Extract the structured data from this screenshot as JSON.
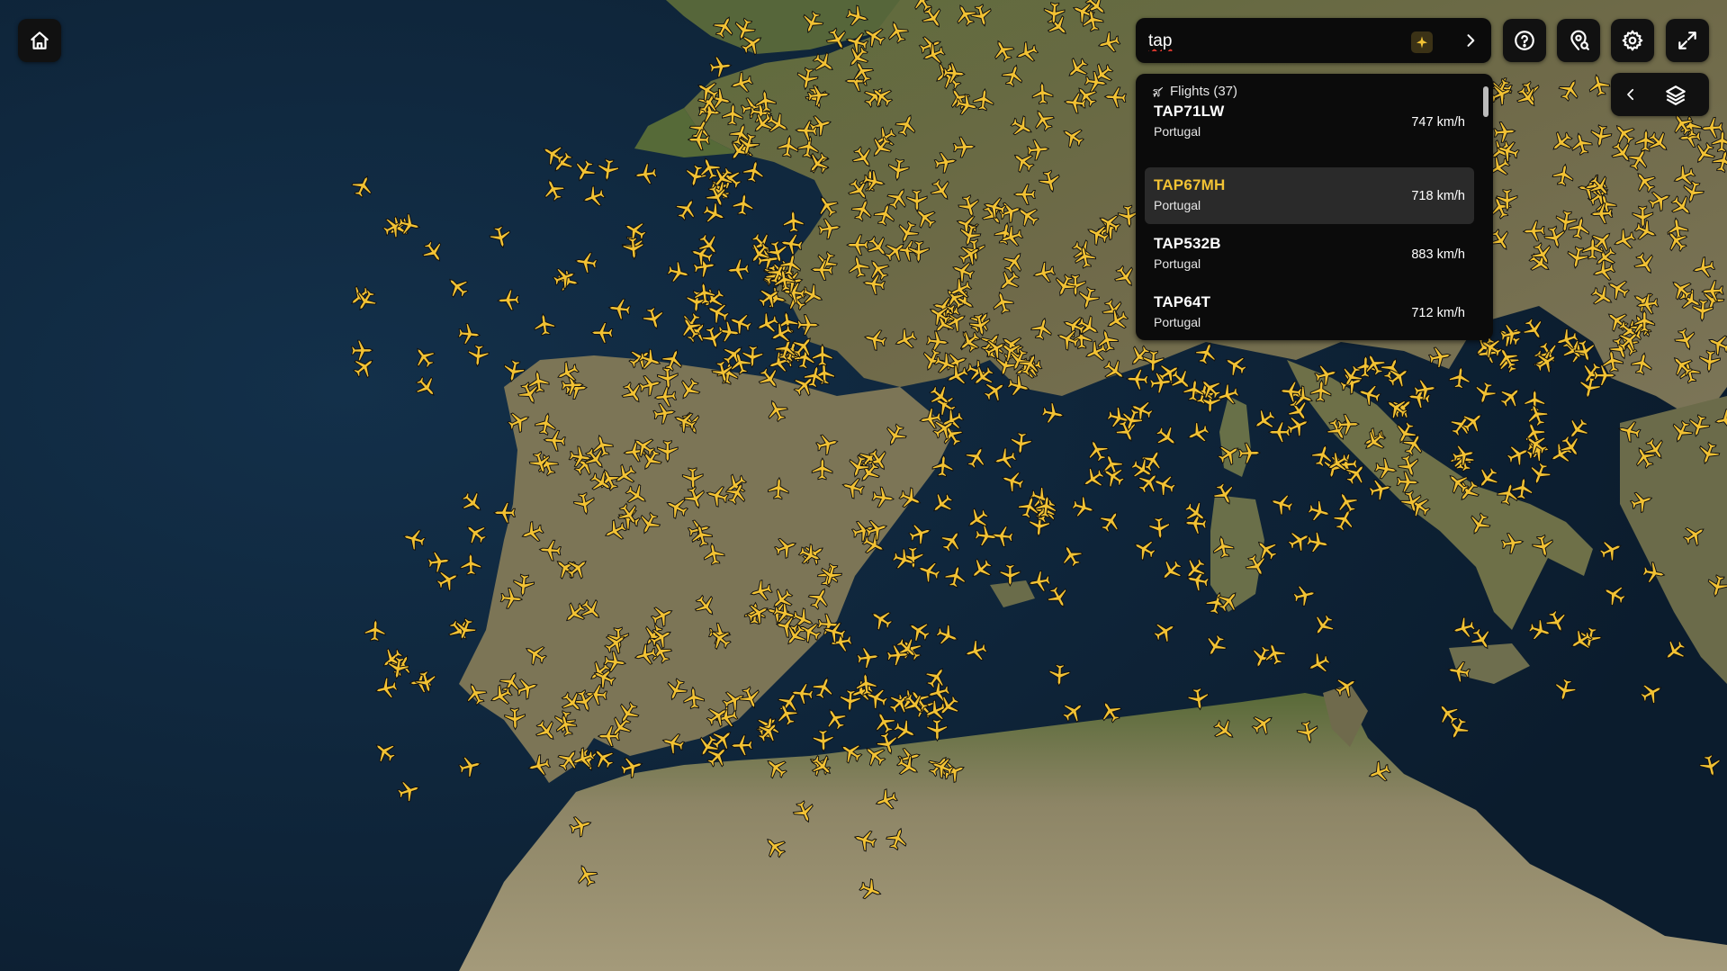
{
  "search": {
    "value": "tap",
    "filter_icon": "plane-filter-icon"
  },
  "results": {
    "header": "Flights (37)",
    "header_icon": "plane-icon",
    "items": [
      {
        "callsign": "TAP71LW",
        "country": "Portugal",
        "speed": "747 km/h"
      },
      {
        "callsign": "TAP67MH",
        "country": "Portugal",
        "speed": "718 km/h"
      },
      {
        "callsign": "TAP532B",
        "country": "Portugal",
        "speed": "883 km/h"
      },
      {
        "callsign": "TAP64T",
        "country": "Portugal",
        "speed": "712 km/h"
      }
    ],
    "selected_index": 1
  },
  "controls": {
    "home": "home-icon",
    "help": "help-circle-icon",
    "location": "location-pin-icon",
    "settings": "gear-icon",
    "fullscreen": "expand-icon",
    "collapse": "chevron-left-icon",
    "layers": "layers-icon"
  },
  "colors": {
    "aircraft": "#f2c234",
    "ocean": "#0e2235",
    "land": "#5d6a3f",
    "panel": "#0b0b0b",
    "highlight": "#f2c234"
  }
}
